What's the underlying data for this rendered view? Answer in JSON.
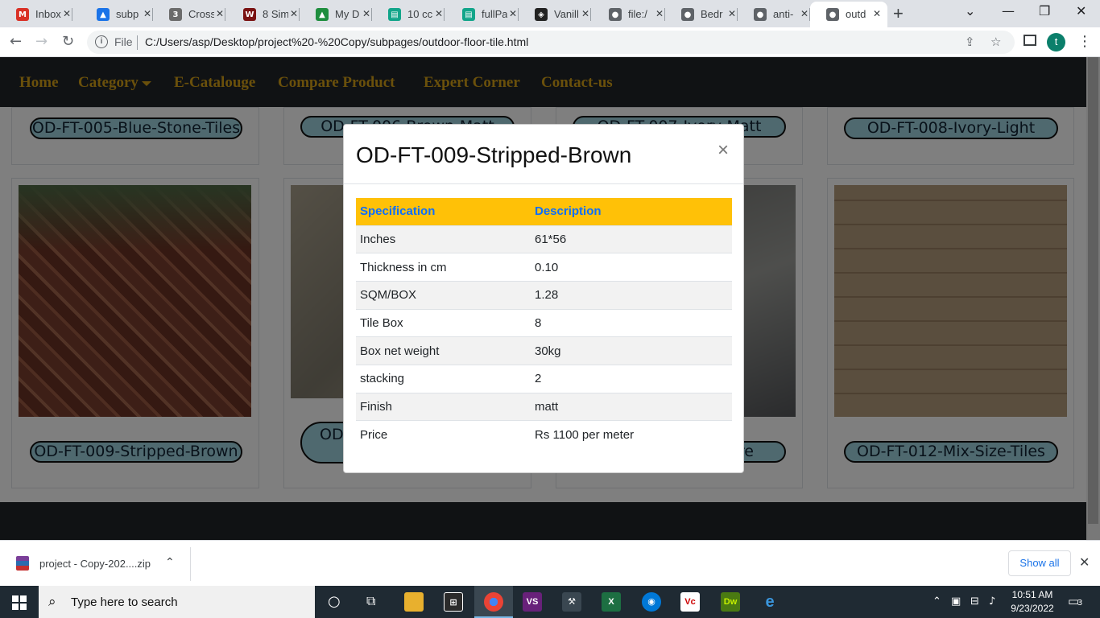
{
  "browser": {
    "tabs": [
      {
        "title": "Inbox",
        "icon": "gmail-icon",
        "color": "#d93025",
        "glyph": "M"
      },
      {
        "title": "subp",
        "icon": "drive-icon",
        "color": "#1a73e8",
        "glyph": "▲"
      },
      {
        "title": "Cross",
        "icon": "css-icon",
        "color": "#6b6b6b",
        "glyph": "3"
      },
      {
        "title": "8 Sim",
        "icon": "w-icon",
        "color": "#7a1212",
        "glyph": "W"
      },
      {
        "title": "My D",
        "icon": "drive-icon",
        "color": "#1e8e3e",
        "glyph": "▲"
      },
      {
        "title": "10 cc",
        "icon": "layout-icon",
        "color": "#12a58a",
        "glyph": "▤"
      },
      {
        "title": "fullPa",
        "icon": "layout-icon",
        "color": "#12a58a",
        "glyph": "▤"
      },
      {
        "title": "Vanill",
        "icon": "codepen-icon",
        "color": "#222222",
        "glyph": "◈"
      },
      {
        "title": "file:/",
        "icon": "globe-icon",
        "color": "#5f6368",
        "glyph": "●"
      },
      {
        "title": "Bedr",
        "icon": "globe-icon",
        "color": "#5f6368",
        "glyph": "●"
      },
      {
        "title": "anti-",
        "icon": "globe-icon",
        "color": "#5f6368",
        "glyph": "●"
      },
      {
        "title": "outd",
        "icon": "globe-icon",
        "color": "#5f6368",
        "glyph": "●",
        "active": true
      }
    ],
    "address": {
      "scheme_label": "File",
      "url": "C:/Users/asp/Desktop/project%20-%20Copy/subpages/outdoor-floor-tile.html"
    },
    "profile_initial": "t"
  },
  "site": {
    "nav": [
      {
        "label": "Home"
      },
      {
        "label": "Category",
        "dropdown": true
      },
      {
        "label": "E-Catalouge"
      },
      {
        "label": "Compare Product"
      },
      {
        "label": "Expert Corner"
      },
      {
        "label": "Contact-us"
      }
    ],
    "products_row1": [
      "OD-FT-005-Blue-Stone-Tiles",
      "OD-FT-006-Brown-Matt",
      "OD-FT-007-Ivory-Matt",
      "OD-FT-008-Ivory-Light"
    ],
    "products_row2": [
      "OD-FT-009-Stripped-Brown",
      "OD-FT-010",
      "OD-FT-011-Texture",
      "OD-FT-012-Mix-Size-Tiles"
    ]
  },
  "modal": {
    "title": "OD-FT-009-Stripped-Brown",
    "close_glyph": "×",
    "headers": [
      "Specification",
      "Description"
    ],
    "rows": [
      [
        "Inches",
        "61*56"
      ],
      [
        "Thickness in cm",
        "0.10"
      ],
      [
        "SQM/BOX",
        "1.28"
      ],
      [
        "Tile Box",
        "8"
      ],
      [
        "Box net weight",
        "30kg"
      ],
      [
        "stacking",
        "2"
      ],
      [
        "Finish",
        "matt"
      ],
      [
        "Price",
        "Rs 1100 per meter"
      ]
    ]
  },
  "downloads": {
    "file_name": "project - Copy-202....zip",
    "show_all": "Show all"
  },
  "taskbar": {
    "search_placeholder": "Type here to search",
    "time": "10:51 AM",
    "date": "9/23/2022",
    "notification_count": "3"
  }
}
